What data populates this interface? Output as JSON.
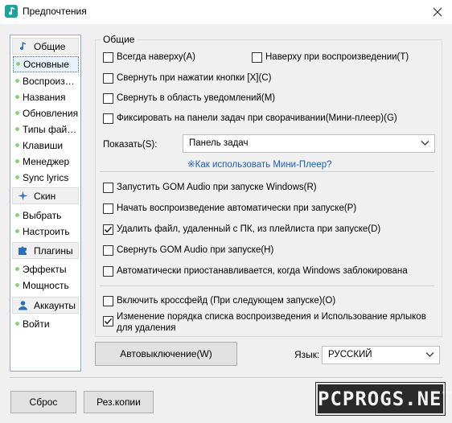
{
  "window": {
    "title": "Предпочтения"
  },
  "sidebar": {
    "sections": [
      {
        "label": "Общие",
        "icon": "music-note-icon",
        "items": [
          "Основные",
          "Воспроизведение",
          "Названия",
          "Обновления",
          "Типы файлов",
          "Клавиши",
          "Менеджер",
          "Sync lyrics"
        ]
      },
      {
        "label": "Скин",
        "icon": "sparkle-icon",
        "items": [
          "Выбрать",
          "Настроить"
        ]
      },
      {
        "label": "Плагины",
        "icon": "puzzle-icon",
        "items": [
          "Эффекты",
          "Мощность"
        ]
      },
      {
        "label": "Аккаунты",
        "icon": "user-icon",
        "items": [
          "Войти"
        ]
      }
    ],
    "selected": "Основные"
  },
  "general": {
    "group_title": "Общие",
    "always_on_top": {
      "label": "Всегда наверху(A)",
      "checked": false
    },
    "on_top_playing": {
      "label": "Наверху при воспроизведении(T)",
      "checked": false
    },
    "minimize_on_x": {
      "label": "Свернуть при нажатии кнопки [X](C)",
      "checked": false
    },
    "minimize_to_tray": {
      "label": "Свернуть в область уведомлений(M)",
      "checked": false
    },
    "pin_taskbar": {
      "label": "Фиксировать на панели задач при сворачивании(Мини-плеер)(G)",
      "checked": false
    },
    "show_label": "Показать(S):",
    "show_value": "Панель задач",
    "mini_player_link": "※Как использовать Мини-Плеер?",
    "launch_startup": {
      "label": "Запустить GOM Audio при запуске Windows(R)",
      "checked": false
    },
    "autoplay_startup": {
      "label": "Начать воспроизведение автоматически при запуске(P)",
      "checked": false
    },
    "delete_from_playlist": {
      "label": "Удалить файл, удаленный с ПК, из плейлиста при запуске(D)",
      "checked": true
    },
    "minimize_at_startup": {
      "label": "Свернуть GOM Audio при запуске(H)",
      "checked": false
    },
    "auto_pause_lock": {
      "label": "Автоматически приостанавливается, когда Windows заблокирована",
      "checked": false
    },
    "crossfade": {
      "label": "Включить кроссфейд (При следующем запуске)(O)",
      "checked": false
    },
    "reorder_playlist": {
      "label": "Изменение порядка списка воспроизведения и Использование ярлыков для удаления",
      "checked": true
    }
  },
  "auto_off_button": "Автовыключение(W)",
  "language": {
    "label": "Язык:",
    "value": "РУССКИЙ"
  },
  "footer": {
    "reset_button": "Сброс",
    "backup_button": "Рез.копии"
  },
  "watermark": "PCPROGS.NET"
}
